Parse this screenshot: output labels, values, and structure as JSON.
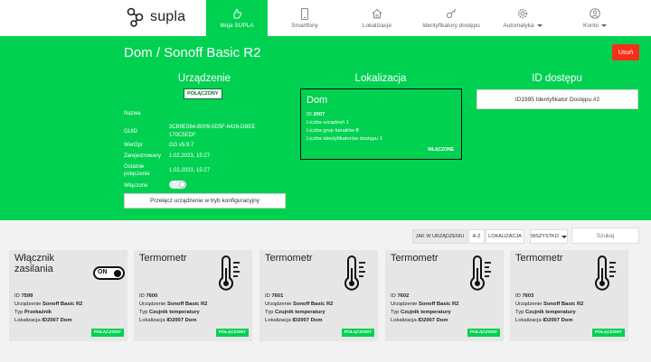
{
  "brand": {
    "name": "supla"
  },
  "nav": [
    {
      "label": "Moja SUPLA",
      "icon": "hand-icon",
      "active": true,
      "caret": false
    },
    {
      "label": "Smartfony",
      "icon": "phone-icon",
      "active": false,
      "caret": false
    },
    {
      "label": "Lokalizacje",
      "icon": "home-icon",
      "active": false,
      "caret": false
    },
    {
      "label": "Identyfikatory dostępu",
      "icon": "key-icon",
      "active": false,
      "caret": false
    },
    {
      "label": "Automatyka",
      "icon": "gear-icon",
      "active": false,
      "caret": true
    },
    {
      "label": "Konto",
      "icon": "user-icon",
      "active": false,
      "caret": true
    }
  ],
  "page": {
    "title": "Dom / Sonoff Basic R2",
    "delete_label": "Usuń"
  },
  "device": {
    "heading": "Urządzenie",
    "status": "POŁĄCZONY",
    "rows": [
      {
        "label": "Nazwa",
        "value": ""
      },
      {
        "label": "GUID",
        "value": "3CB9E564-B009-0D5F-6426-DBEE170C5EDF"
      },
      {
        "label": "WerOpr",
        "value": "GG v5.9.7"
      },
      {
        "label": "Zarejestrowany",
        "value": "1.02.2023, 15:27"
      },
      {
        "label": "Ostatnie połączenie",
        "value": "1.02.2023, 15:27"
      },
      {
        "label": "Włączone",
        "value": ""
      }
    ],
    "enabled": true,
    "config_button": "Przełącz urządzenie w tryb konfiguracyjny"
  },
  "location": {
    "heading": "Lokalizacja",
    "name": "Dom",
    "id_label": "ID",
    "id": "2007",
    "devices_label": "Liczba urządzeń",
    "devices": "1",
    "groups_label": "Liczba grup kanałów",
    "groups": "0",
    "access_label": "Liczba identyfikatorów dostępu",
    "access": "1",
    "status": "WŁĄCZONE"
  },
  "access_id": {
    "heading": "ID dostępu",
    "button": "ID1995 Identyfikator Dostępu #2"
  },
  "filters": {
    "by_device": "JAK W URZĄDZENIU",
    "az": "A-Z",
    "by_location": "LOKALIZACJA",
    "all": "WSZYSTKO",
    "search_placeholder": "Szukaj"
  },
  "channels": [
    {
      "title": "Włącznik zasilania",
      "icon": "power-switch-icon",
      "switch_text": "ON",
      "id": "7599",
      "device": "Sonoff Basic R2",
      "type_label": "Typ",
      "type": "Przekaźnik",
      "location": "ID2007 Dom",
      "status": "POŁĄCZONY"
    },
    {
      "title": "Termometr",
      "icon": "thermometer-icon",
      "id": "7600",
      "device": "Sonoff Basic R2",
      "type_label": "Typ",
      "type": "Czujnik temperatury",
      "location": "ID2007 Dom",
      "status": "POŁĄCZONY"
    },
    {
      "title": "Termometr",
      "icon": "thermometer-icon",
      "id": "7601",
      "device": "Sonoff Basic R2",
      "type_label": "Typ",
      "type": "Czujnik temperatury",
      "location": "ID2007 Dom",
      "status": "POŁĄCZONY"
    },
    {
      "title": "Termometr",
      "icon": "thermometer-icon",
      "id": "7602",
      "device": "Sonoff Basic R2",
      "type_label": "Typ",
      "type": "Czujnik temperatury",
      "location": "ID2007 Dom",
      "status": "POŁĄCZONY"
    },
    {
      "title": "Termometr",
      "icon": "thermometer-icon",
      "id": "7603",
      "device": "Sonoff Basic R2",
      "type_label": "Typ",
      "type": "Czujnik temperatury",
      "location": "ID2007 Dom",
      "status": "POŁĄCZONY"
    }
  ],
  "labels": {
    "id": "ID",
    "device": "Urządzenie",
    "location": "Lokalizacja"
  },
  "colors": {
    "accent": "#00d151",
    "danger": "#f5301a"
  }
}
